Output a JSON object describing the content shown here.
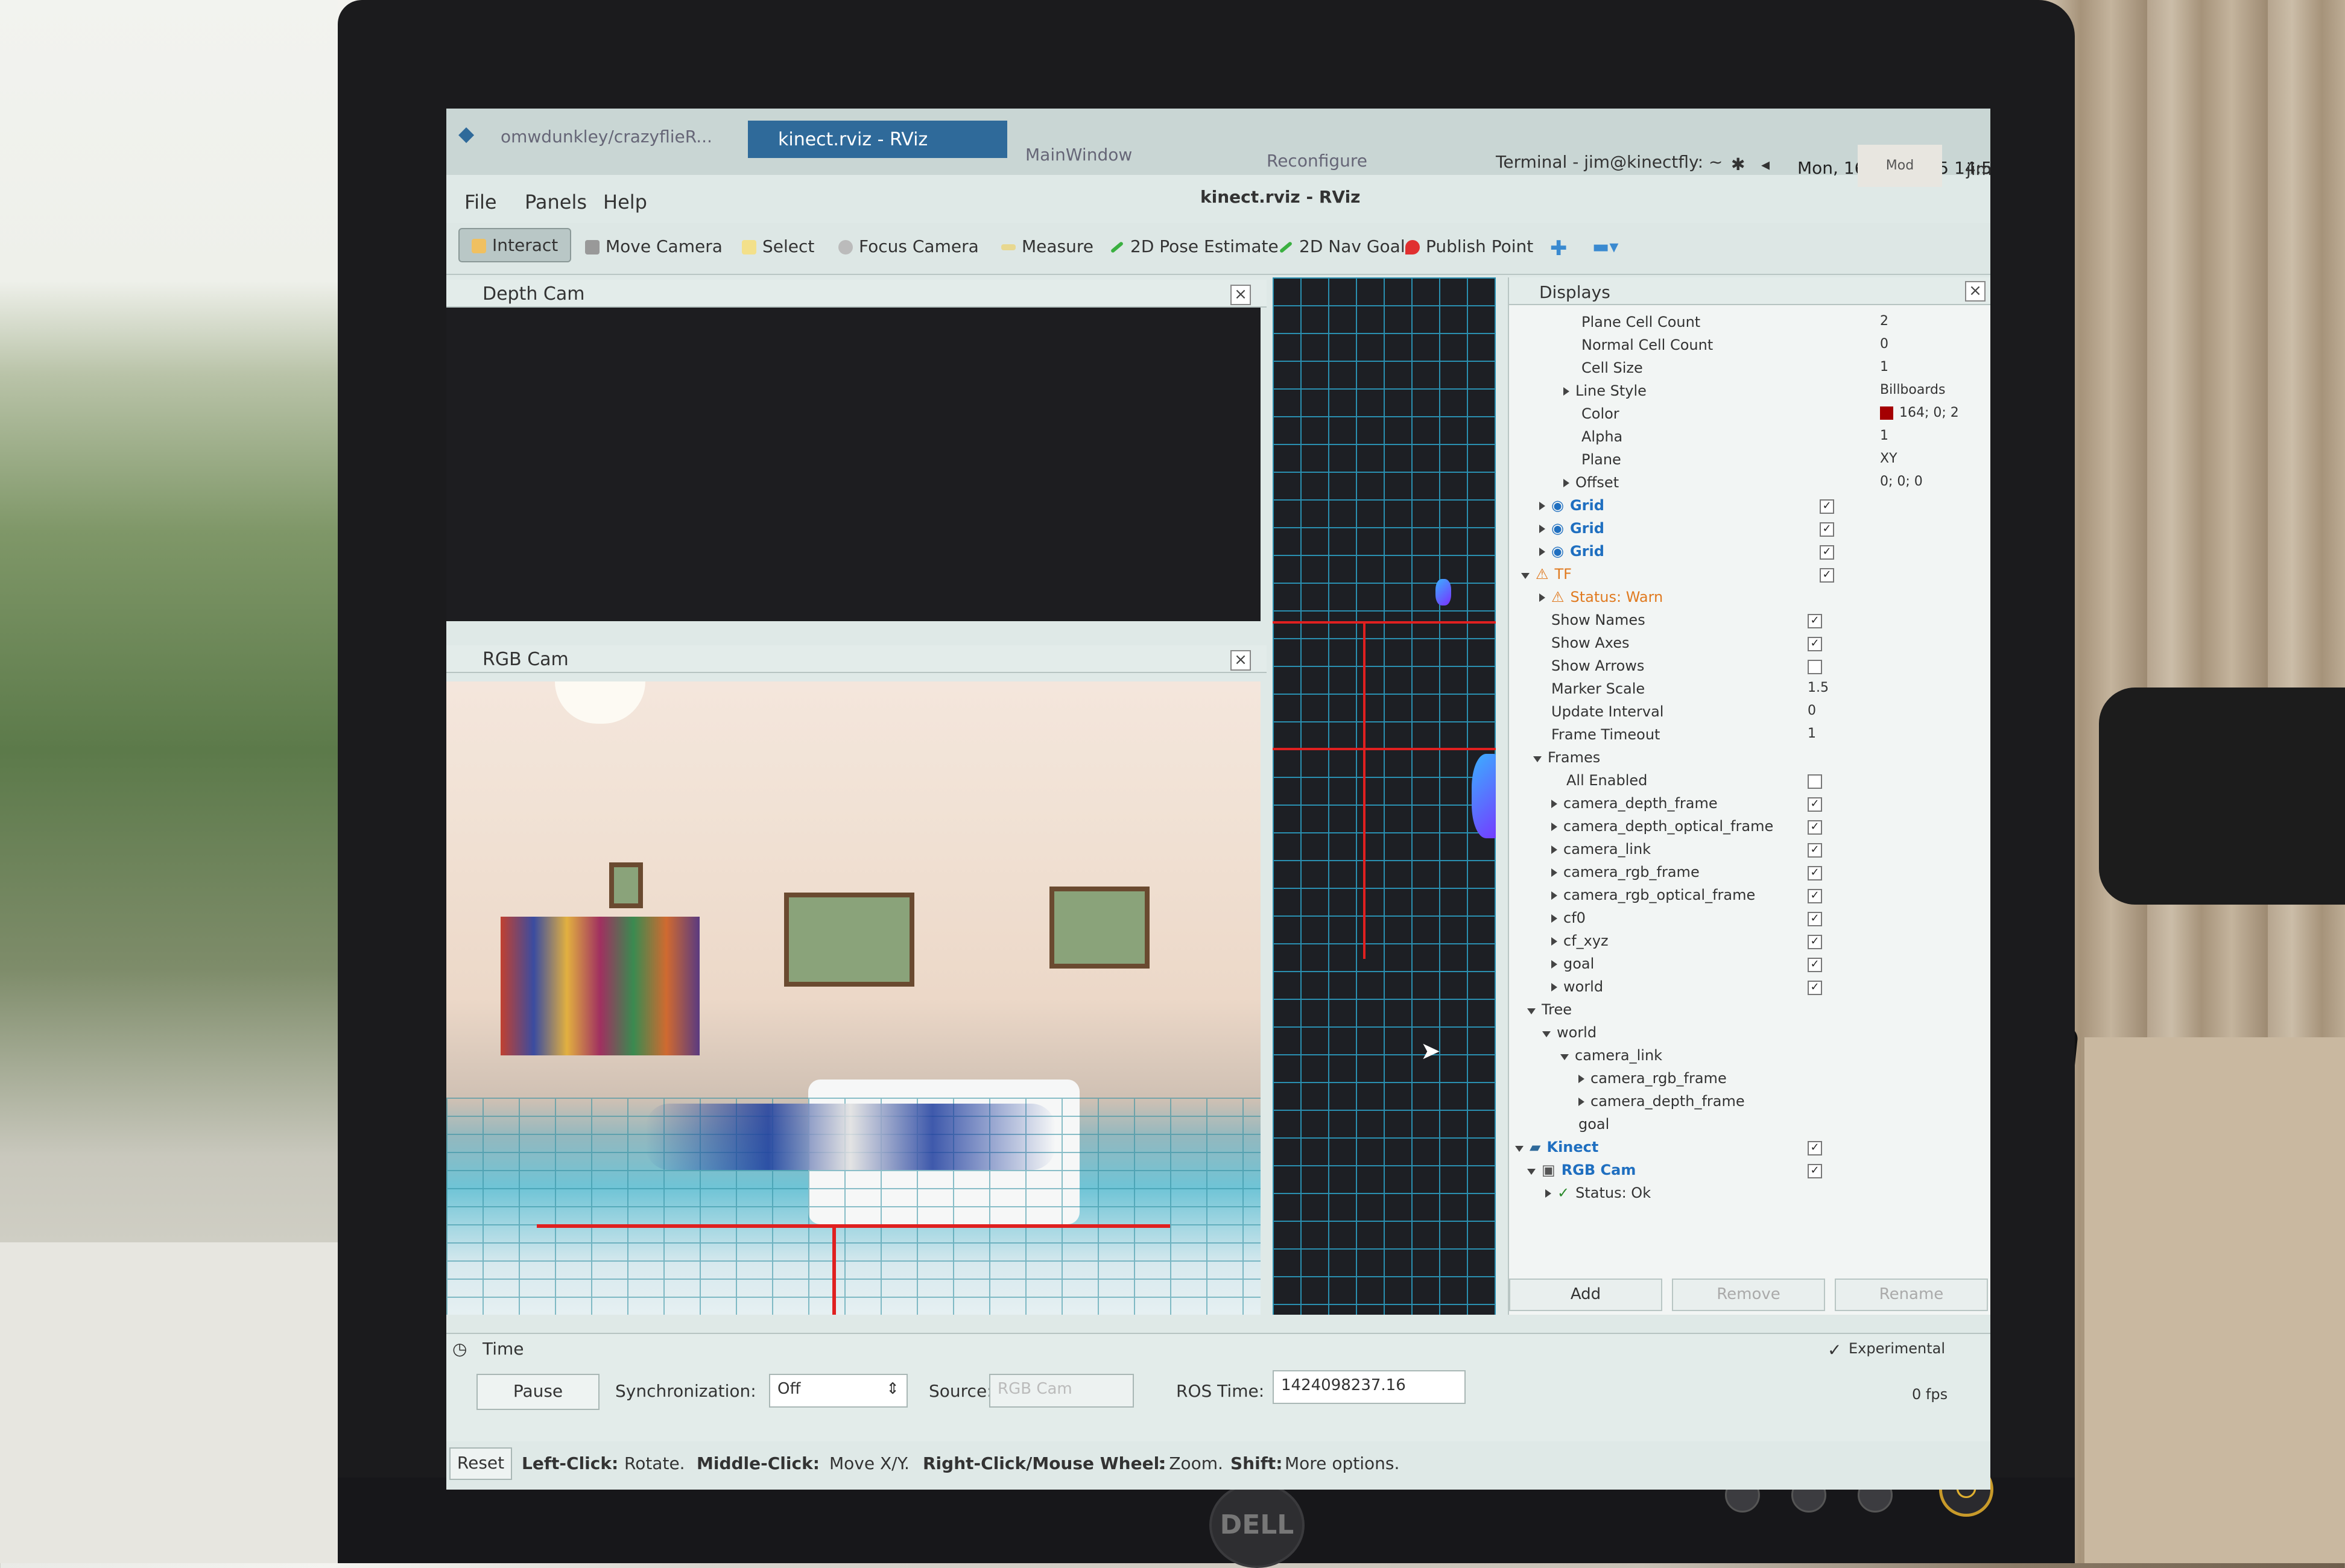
{
  "taskbar": {
    "tab1": "omwdunkley/crazyflieR...",
    "active_tab": "kinect.rviz - RViz",
    "tab3": "MainWindow",
    "tab4": "Reconfigure",
    "terminal": "Terminal - jim@kinectfly: ~",
    "datetime": "Mon, 16 Feb 2015 14:50",
    "user": "jim",
    "badge": "Mod"
  },
  "window": {
    "title": "kinect.rviz - RViz"
  },
  "menu": {
    "file": "File",
    "panels": "Panels",
    "help": "Help"
  },
  "toolbar": {
    "interact": "Interact",
    "move_camera": "Move Camera",
    "select": "Select",
    "focus_camera": "Focus Camera",
    "measure": "Measure",
    "pose_estimate": "2D Pose Estimate",
    "nav_goal": "2D Nav Goal",
    "publish_point": "Publish Point"
  },
  "panels": {
    "depth_cam": "Depth Cam",
    "rgb_cam": "RGB Cam"
  },
  "displays": {
    "title": "Displays",
    "rows": [
      {
        "label": "Plane Cell Count",
        "value": "2"
      },
      {
        "label": "Normal Cell Count",
        "value": "0"
      },
      {
        "label": "Cell Size",
        "value": "1"
      },
      {
        "label": "Line Style",
        "value": "Billboards"
      },
      {
        "label": "Color",
        "value": "164; 0; 2"
      },
      {
        "label": "Alpha",
        "value": "1"
      },
      {
        "label": "Plane",
        "value": "XY"
      },
      {
        "label": "Offset",
        "value": "0; 0; 0"
      },
      {
        "label": "Grid"
      },
      {
        "label": "Grid"
      },
      {
        "label": "Grid"
      },
      {
        "label": "TF"
      },
      {
        "label": "Status: Warn"
      },
      {
        "label": "Show Names"
      },
      {
        "label": "Show Axes"
      },
      {
        "label": "Show Arrows"
      },
      {
        "label": "Marker Scale",
        "value": "1.5"
      },
      {
        "label": "Update Interval",
        "value": "0"
      },
      {
        "label": "Frame Timeout",
        "value": "1"
      },
      {
        "label": "Frames"
      },
      {
        "label": "All Enabled"
      },
      {
        "label": "camera_depth_frame"
      },
      {
        "label": "camera_depth_optical_frame"
      },
      {
        "label": "camera_link"
      },
      {
        "label": "camera_rgb_frame"
      },
      {
        "label": "camera_rgb_optical_frame"
      },
      {
        "label": "cf0"
      },
      {
        "label": "cf_xyz"
      },
      {
        "label": "goal"
      },
      {
        "label": "world"
      },
      {
        "label": "Tree"
      },
      {
        "label": "world"
      },
      {
        "label": "camera_link"
      },
      {
        "label": "camera_rgb_frame"
      },
      {
        "label": "camera_depth_frame"
      },
      {
        "label": "goal"
      },
      {
        "label": "Kinect"
      },
      {
        "label": "RGB Cam"
      },
      {
        "label": "Status: Ok"
      }
    ],
    "add": "Add",
    "remove": "Remove",
    "rename": "Rename"
  },
  "time": {
    "title": "Time",
    "pause": "Pause",
    "sync_label": "Synchronization:",
    "sync_value": "Off",
    "source_label": "Source:",
    "source_value": "RGB Cam",
    "ros_time_label": "ROS Time:",
    "ros_time_value": "1424098237.16",
    "experimental": "Experimental",
    "fps": "0 fps"
  },
  "status": {
    "reset": "Reset",
    "left_click": "Left-Click:",
    "left_click_desc": "Rotate.",
    "middle_click": "Middle-Click:",
    "middle_click_desc": "Move X/Y.",
    "right_click": "Right-Click/Mouse Wheel:",
    "right_click_desc": ": Zoom.",
    "shift": "Shift:",
    "shift_desc": "More options."
  },
  "monitor": {
    "brand": "DELL"
  },
  "colors": {
    "grid_color": "#a40002",
    "accent": "#2f6a9a"
  }
}
